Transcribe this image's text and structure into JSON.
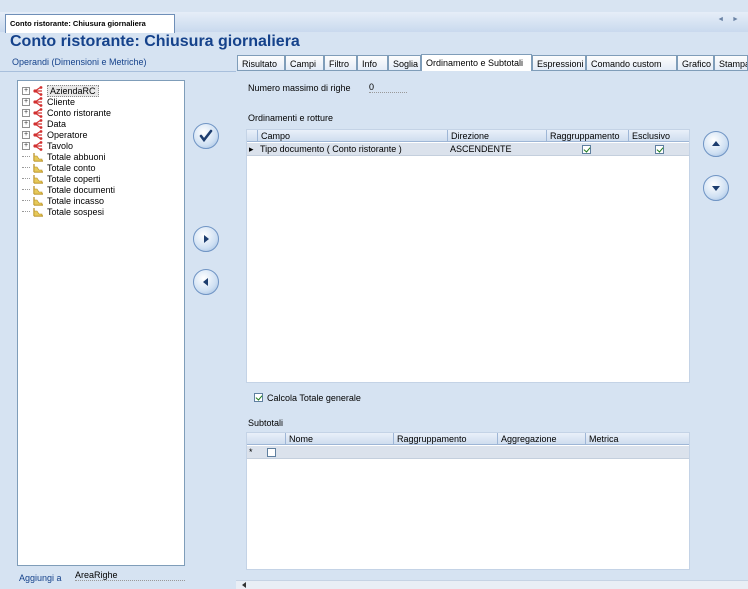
{
  "document_tab": {
    "label": "Conto ristorante: Chiusura giornaliera",
    "nav": "◄ ►"
  },
  "page_title": "Conto ristorante: Chiusura giornaliera",
  "left_panel": {
    "header": "Operandi (Dimensioni e Metriche)",
    "tree": [
      {
        "label": "AziendaRC",
        "type": "dimension",
        "expandable": true,
        "selected": true
      },
      {
        "label": "Cliente",
        "type": "dimension",
        "expandable": true
      },
      {
        "label": "Conto ristorante",
        "type": "dimension",
        "expandable": true
      },
      {
        "label": "Data",
        "type": "dimension",
        "expandable": true
      },
      {
        "label": "Operatore",
        "type": "dimension",
        "expandable": true
      },
      {
        "label": "Tavolo",
        "type": "dimension",
        "expandable": true
      },
      {
        "label": "Totale abbuoni",
        "type": "metric",
        "expandable": false
      },
      {
        "label": "Totale conto",
        "type": "metric",
        "expandable": false
      },
      {
        "label": "Totale coperti",
        "type": "metric",
        "expandable": false
      },
      {
        "label": "Totale documenti",
        "type": "metric",
        "expandable": false
      },
      {
        "label": "Totale incasso",
        "type": "metric",
        "expandable": false
      },
      {
        "label": "Totale sospesi",
        "type": "metric",
        "expandable": false
      }
    ],
    "aggiungi_label": "Aggiungi a",
    "aggiungi_value": "AreaRighe"
  },
  "tabs": [
    {
      "label": "Risultato"
    },
    {
      "label": "Campi"
    },
    {
      "label": "Filtro"
    },
    {
      "label": "Info"
    },
    {
      "label": "Soglia"
    },
    {
      "label": "Ordinamento e Subtotali",
      "active": true
    },
    {
      "label": "Espressioni"
    },
    {
      "label": "Comando custom"
    },
    {
      "label": "Grafico"
    },
    {
      "label": "Stampa"
    }
  ],
  "ordering": {
    "max_rows_label": "Numero massimo di righe",
    "max_rows_value": "0",
    "section_label": "Ordinamenti e rotture",
    "columns": [
      "Campo",
      "Direzione",
      "Raggruppamento",
      "Esclusivo"
    ],
    "rows": [
      {
        "campo": "Tipo documento ( Conto ristorante )",
        "direzione": "ASCENDENTE",
        "raggruppamento": true,
        "esclusivo": true
      }
    ]
  },
  "totals": {
    "grand_total_label": "Calcola Totale generale",
    "grand_total_checked": true,
    "subtotals_label": "Subtotali",
    "columns": [
      "Nome",
      "Raggruppamento",
      "Aggregazione",
      "Metrica"
    ],
    "new_row_marker": "*"
  },
  "colors": {
    "accent": "#15428b",
    "panel_bg": "#d6e3f2",
    "grid_row": "#dbe2ec"
  }
}
